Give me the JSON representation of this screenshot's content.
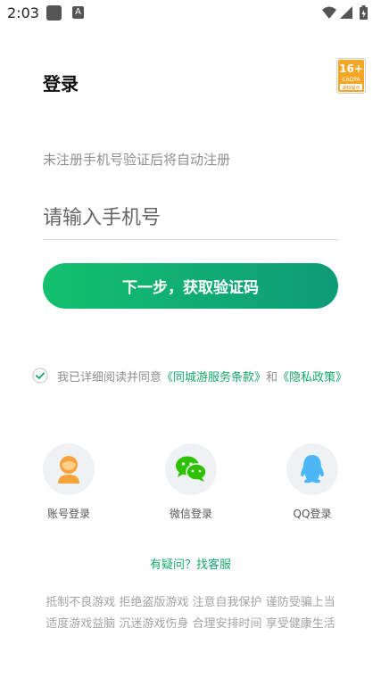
{
  "status_bar": {
    "time": "2:03",
    "notification_letter": "A",
    "icons": [
      "notification-square-icon",
      "font-a-icon",
      "wifi-icon",
      "signal-icon",
      "battery-charging-icon"
    ]
  },
  "header": {
    "title": "登录",
    "age_badge": {
      "rating": "16+",
      "org": "CADPA",
      "caption": "适龄提示"
    }
  },
  "form": {
    "hint": "未注册手机号验证后将自动注册",
    "phone_placeholder": "请输入手机号",
    "phone_value": "",
    "next_button": "下一步，获取验证码"
  },
  "agreement": {
    "checked": true,
    "prefix": "我已详细阅读并同意",
    "terms_link": "《同城游服务条款》",
    "conjunction": "和",
    "privacy_link": "《隐私政策》"
  },
  "login_options": [
    {
      "label": "账号登录",
      "icon": "account-avatar-icon"
    },
    {
      "label": "微信登录",
      "icon": "wechat-icon"
    },
    {
      "label": "QQ登录",
      "icon": "qq-penguin-icon"
    }
  ],
  "help_link": "有疑问？找客服",
  "footer": {
    "line1": "抵制不良游戏 拒绝盗版游戏 注意自我保护 谨防受骗上当",
    "line2": "适度游戏益脑 沉迷游戏伤身 合理安排时间 享受健康生活"
  },
  "colors": {
    "accent_green": "#13c06d",
    "accent_green_dark": "#0e9b78",
    "link_green": "#13a86a",
    "hint_gray": "#8e8e8e",
    "badge_orange": "#f5a623"
  }
}
